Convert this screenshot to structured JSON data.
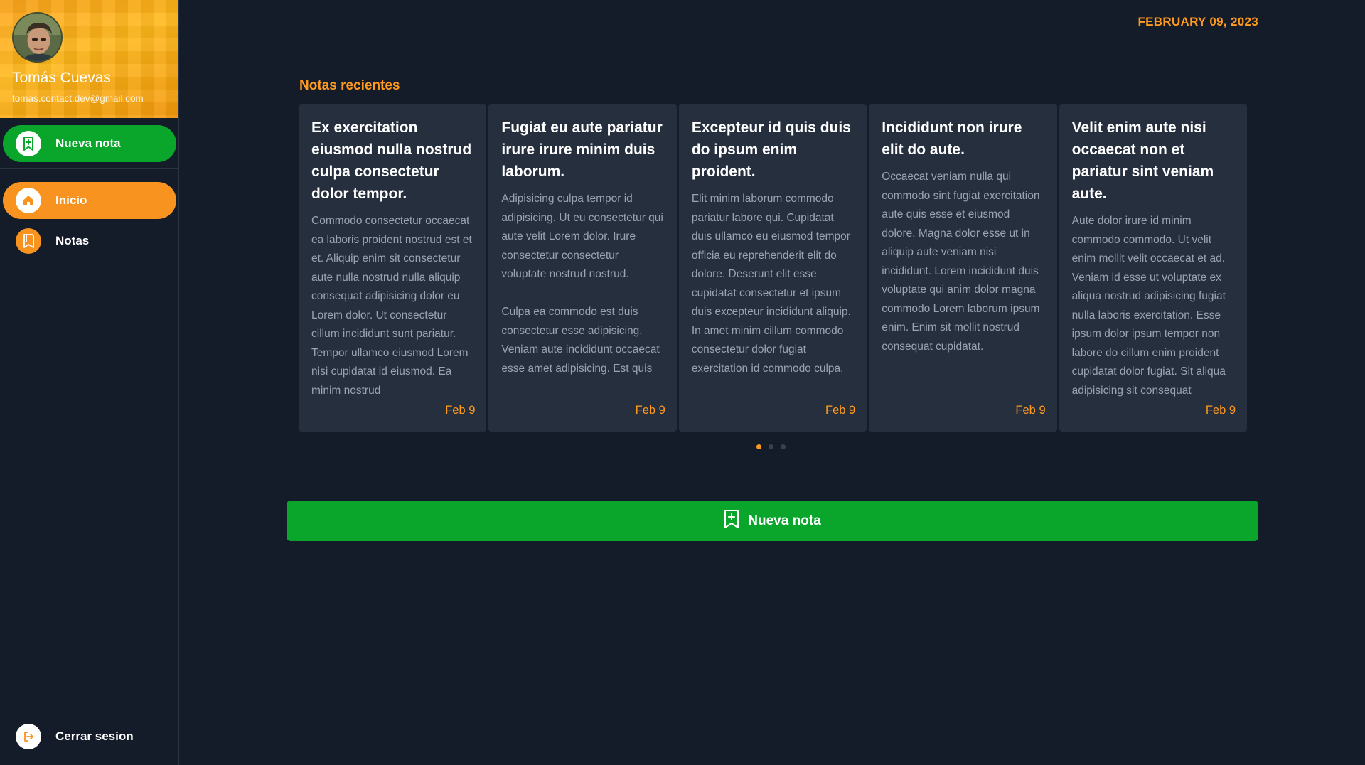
{
  "user": {
    "name": "Tomás Cuevas",
    "email": "tomas.contact.dev@gmail.com"
  },
  "sidebar": {
    "new_note_label": "Nueva nota",
    "items": [
      {
        "label": "Inicio",
        "icon": "home-icon",
        "active": true
      },
      {
        "label": "Notas",
        "icon": "notes-icon",
        "active": false
      }
    ],
    "logout_label": "Cerrar sesion"
  },
  "header": {
    "date": "FEBRUARY 09, 2023"
  },
  "main": {
    "section_title": "Notas recientes",
    "notes": [
      {
        "title": "Ex exercitation eiusmod nulla nostrud culpa consectetur dolor tempor.",
        "body": "Commodo consectetur occaecat ea laboris proident nostrud est et et. Aliquip enim sit consectetur aute nulla nostrud nulla aliquip consequat adipisicing dolor eu Lorem dolor. Ut consectetur cillum incididunt sunt pariatur. Tempor ullamco eiusmod Lorem nisi cupidatat id eiusmod. Ea minim nostrud",
        "date": "Feb 9"
      },
      {
        "title": "Fugiat eu aute pariatur irure irure minim duis laborum.",
        "body": "Adipisicing culpa tempor id adipisicing. Ut eu consectetur qui aute velit Lorem dolor. Irure consectetur consectetur voluptate nostrud nostrud.\n\nCulpa ea commodo est duis consectetur esse adipisicing. Veniam aute incididunt occaecat esse amet adipisicing. Est quis velit occaecat ex eiusmod nisi",
        "date": "Feb 9"
      },
      {
        "title": "Excepteur id quis duis do ipsum enim proident.",
        "body": "Elit minim laborum commodo pariatur labore qui. Cupidatat duis ullamco eu eiusmod tempor officia eu reprehenderit elit do dolore. Deserunt elit esse cupidatat consectetur et ipsum duis excepteur incididunt aliquip. In amet minim cillum commodo consectetur dolor fugiat exercitation id commodo culpa. Qui proident veniam amet",
        "date": "Feb 9"
      },
      {
        "title": "Incididunt non irure elit do aute.",
        "body": "Occaecat veniam nulla qui commodo sint fugiat exercitation aute quis esse et eiusmod dolore. Magna dolor esse ut in aliquip aute veniam nisi incididunt. Lorem incididunt duis voluptate qui anim dolor magna commodo Lorem laborum ipsum enim. Enim sit mollit nostrud consequat cupidatat.",
        "date": "Feb 9"
      },
      {
        "title": "Velit enim aute nisi occaecat non et pariatur sint veniam aute.",
        "body": "Aute dolor irure id minim commodo commodo. Ut velit enim mollit velit occaecat et ad. Veniam id esse ut voluptate ex aliqua nostrud adipisicing fugiat nulla laboris exercitation. Esse ipsum dolor ipsum tempor non labore do cillum enim proident cupidatat dolor fugiat. Sit aliqua adipisicing sit consequat",
        "date": "Feb 9"
      }
    ],
    "pagination": {
      "pages": 3,
      "current": 1
    },
    "new_note_button_label": "Nueva nota"
  },
  "colors": {
    "accent_orange": "#ff9a1f",
    "green": "#0aa62b",
    "background": "#151c29",
    "card": "#252f3e"
  }
}
